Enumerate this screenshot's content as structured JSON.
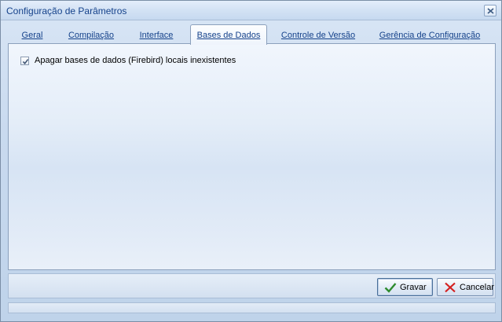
{
  "window": {
    "title": "Configuração de Parâmetros",
    "close_icon": "close-icon"
  },
  "tabs": [
    {
      "label": "Geral",
      "active": false
    },
    {
      "label": "Compilação",
      "active": false
    },
    {
      "label": "Interface",
      "active": false
    },
    {
      "label": "Bases de Dados",
      "active": true
    },
    {
      "label": "Controle de Versão",
      "active": false
    },
    {
      "label": "Gerência de Configuração",
      "active": false
    }
  ],
  "options": {
    "drop_local_db": {
      "label": "Apagar bases de dados (Firebird) locais inexistentes",
      "checked": true
    }
  },
  "buttons": {
    "save": {
      "label": "Gravar",
      "icon": "checkmark-icon",
      "accent": "#2e8b2e"
    },
    "cancel": {
      "label": "Cancelar",
      "icon": "x-icon",
      "accent": "#d42020"
    }
  }
}
